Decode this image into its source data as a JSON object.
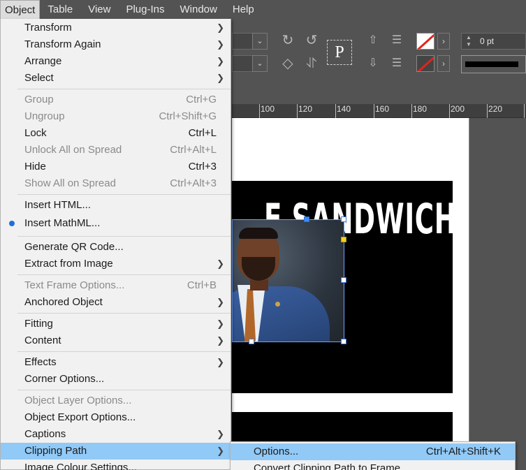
{
  "menubar": {
    "items": [
      "Object",
      "Table",
      "View",
      "Plug-Ins",
      "Window",
      "Help"
    ]
  },
  "control_panel": {
    "stroke_weight": "0 pt",
    "placeholder_glyph": "P"
  },
  "ruler": {
    "labels": [
      "100",
      "120",
      "140",
      "160",
      "180",
      "200",
      "220"
    ]
  },
  "document": {
    "headline": "E SANDWICH"
  },
  "object_menu": {
    "items": [
      {
        "label": "Transform",
        "shortcut": "",
        "submenu": true,
        "disabled": false
      },
      {
        "label": "Transform Again",
        "shortcut": "",
        "submenu": true,
        "disabled": false
      },
      {
        "label": "Arrange",
        "shortcut": "",
        "submenu": true,
        "disabled": false
      },
      {
        "label": "Select",
        "shortcut": "",
        "submenu": true,
        "disabled": false
      },
      {
        "label": "Group",
        "shortcut": "Ctrl+G",
        "submenu": false,
        "disabled": true
      },
      {
        "label": "Ungroup",
        "shortcut": "Ctrl+Shift+G",
        "submenu": false,
        "disabled": true
      },
      {
        "label": "Lock",
        "shortcut": "Ctrl+L",
        "submenu": false,
        "disabled": false
      },
      {
        "label": "Unlock All on Spread",
        "shortcut": "Ctrl+Alt+L",
        "submenu": false,
        "disabled": true
      },
      {
        "label": "Hide",
        "shortcut": "Ctrl+3",
        "submenu": false,
        "disabled": false
      },
      {
        "label": "Show All on Spread",
        "shortcut": "Ctrl+Alt+3",
        "submenu": false,
        "disabled": true
      },
      {
        "label": "Insert HTML...",
        "shortcut": "",
        "submenu": false,
        "disabled": false
      },
      {
        "label": "Insert MathML...",
        "shortcut": "",
        "submenu": false,
        "disabled": false
      },
      {
        "label": "Generate QR Code...",
        "shortcut": "",
        "submenu": false,
        "disabled": false
      },
      {
        "label": "Extract from Image",
        "shortcut": "",
        "submenu": true,
        "disabled": false
      },
      {
        "label": "Text Frame Options...",
        "shortcut": "Ctrl+B",
        "submenu": false,
        "disabled": true
      },
      {
        "label": "Anchored Object",
        "shortcut": "",
        "submenu": true,
        "disabled": false
      },
      {
        "label": "Fitting",
        "shortcut": "",
        "submenu": true,
        "disabled": false
      },
      {
        "label": "Content",
        "shortcut": "",
        "submenu": true,
        "disabled": false
      },
      {
        "label": "Effects",
        "shortcut": "",
        "submenu": true,
        "disabled": false
      },
      {
        "label": "Corner Options...",
        "shortcut": "",
        "submenu": false,
        "disabled": false
      },
      {
        "label": "Object Layer Options...",
        "shortcut": "",
        "submenu": false,
        "disabled": true
      },
      {
        "label": "Object Export Options...",
        "shortcut": "",
        "submenu": false,
        "disabled": false
      },
      {
        "label": "Captions",
        "shortcut": "",
        "submenu": true,
        "disabled": false
      },
      {
        "label": "Clipping Path",
        "shortcut": "",
        "submenu": true,
        "disabled": false
      },
      {
        "label": "Image Colour Settings...",
        "shortcut": "",
        "submenu": false,
        "disabled": false
      }
    ]
  },
  "clipping_path_submenu": {
    "items": [
      {
        "label": "Options...",
        "shortcut": "Ctrl+Alt+Shift+K"
      },
      {
        "label": "Convert Clipping Path to Frame",
        "shortcut": ""
      }
    ]
  },
  "colors": {
    "menu_highlight": "#91c9f7",
    "menu_background": "#f1f1f1",
    "app_background": "#535353",
    "selection_blue": "#3d8cf5"
  }
}
